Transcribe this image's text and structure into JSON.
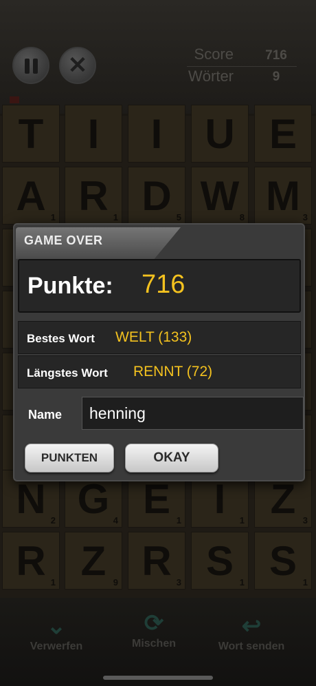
{
  "header": {
    "score_label": "Score",
    "score_value": "716",
    "words_label": "Wörter",
    "words_value": "9"
  },
  "board": {
    "row1": [
      {
        "letter": "T",
        "points": ""
      },
      {
        "letter": "I",
        "points": ""
      },
      {
        "letter": "I",
        "points": ""
      },
      {
        "letter": "U",
        "points": ""
      },
      {
        "letter": "E",
        "points": ""
      }
    ],
    "row2": [
      {
        "letter": "A",
        "points": "1"
      },
      {
        "letter": "R",
        "points": "1"
      },
      {
        "letter": "D",
        "points": "5"
      },
      {
        "letter": "W",
        "points": "8"
      },
      {
        "letter": "M",
        "points": "3"
      }
    ],
    "row7": [
      {
        "letter": "N",
        "points": "2"
      },
      {
        "letter": "G",
        "points": "4"
      },
      {
        "letter": "E",
        "points": "1"
      },
      {
        "letter": "I",
        "points": "1"
      },
      {
        "letter": "Z",
        "points": "3"
      }
    ],
    "row8": [
      {
        "letter": "R",
        "points": "1"
      },
      {
        "letter": "Z",
        "points": "9"
      },
      {
        "letter": "R",
        "points": "3"
      },
      {
        "letter": "S",
        "points": "1"
      },
      {
        "letter": "S",
        "points": "1"
      }
    ]
  },
  "toolbar": {
    "discard_label": "Verwerfen",
    "shuffle_label": "Mischen",
    "send_label": "Wort senden"
  },
  "dialog": {
    "title": "GAME OVER",
    "points_label": "Punkte:",
    "points_value": "716",
    "best_word_label": "Bestes Wort",
    "best_word_value": "WELT (133)",
    "longest_word_label": "Längstes Wort",
    "longest_word_value": "RENNT (72)",
    "name_label": "Name",
    "name_value": "henning",
    "punkten_button": "PUNKTEN",
    "okay_button": "OKAY"
  },
  "icons": {
    "pause": "pause-icon",
    "close": "close-icon",
    "discard": "double-chevron-down-icon",
    "shuffle": "shuffle-icon",
    "send": "send-arrow-icon"
  },
  "colors": {
    "accent": "#f4c21f",
    "dialog_bg": "#3a3a3a",
    "toolbar_icon": "#1f3e37"
  }
}
